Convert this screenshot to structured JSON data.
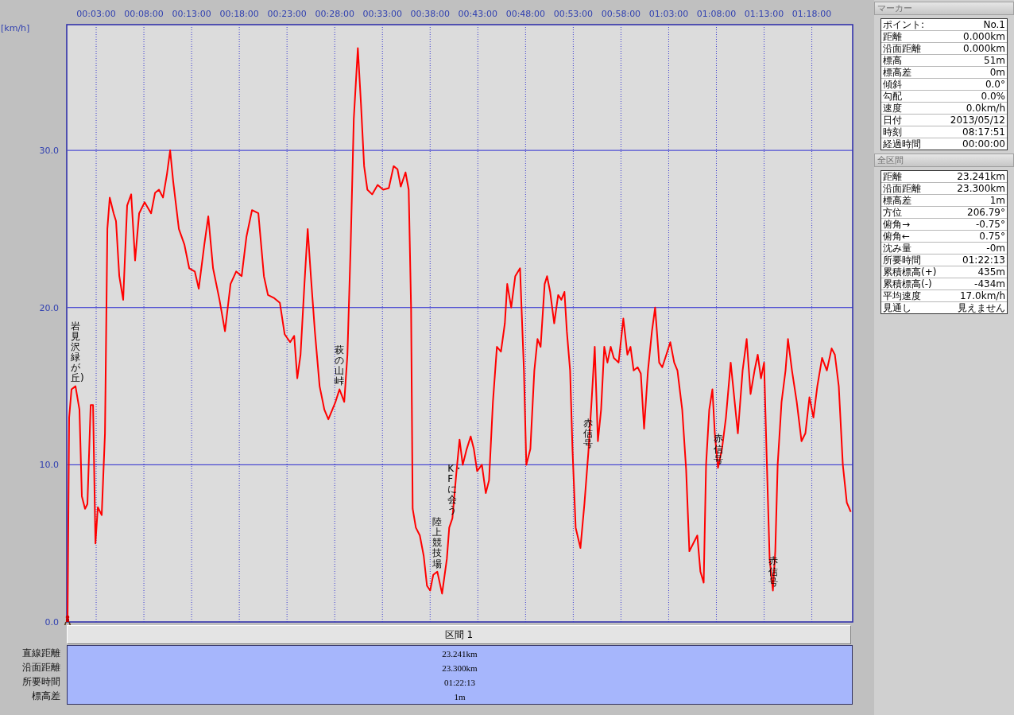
{
  "chart": {
    "chart_data": {
      "type": "line",
      "ylabel": "[km/h]",
      "x": [
        0,
        0.17,
        0.42,
        0.83,
        1.25,
        1.5,
        1.83,
        2.08,
        2.42,
        2.67,
        2.92,
        3.17,
        3.58,
        3.92,
        4.17,
        4.42,
        4.83,
        5.08,
        5.42,
        5.83,
        6.25,
        6.67,
        7.08,
        7.5,
        8.08,
        8.75,
        9.17,
        9.58,
        10,
        10.42,
        10.75,
        11.08,
        11.67,
        12.25,
        12.75,
        13.33,
        13.75,
        14.33,
        14.75,
        15.25,
        15.92,
        16.5,
        17.08,
        17.67,
        18.25,
        18.75,
        19.33,
        20,
        20.58,
        21,
        21.67,
        22.25,
        22.75,
        23.33,
        23.75,
        24.08,
        24.42,
        24.83,
        25.17,
        25.5,
        25.92,
        26.42,
        26.92,
        27.33,
        27.75,
        28.08,
        28.5,
        29,
        29.33,
        29.67,
        30,
        30.42,
        30.75,
        31.08,
        31.42,
        31.92,
        32.5,
        33.08,
        33.67,
        34.17,
        34.58,
        34.92,
        35.42,
        35.75,
        36,
        36.17,
        36.5,
        36.92,
        37.33,
        37.67,
        38,
        38.33,
        38.75,
        39.25,
        39.75,
        40,
        40.33,
        40.75,
        41.08,
        41.42,
        41.83,
        42.25,
        42.58,
        42.92,
        43.42,
        43.83,
        44.17,
        44.58,
        45,
        45.42,
        45.83,
        46.08,
        46.5,
        46.92,
        47.42,
        47.83,
        48.08,
        48.5,
        48.92,
        49.25,
        49.58,
        50,
        50.25,
        50.58,
        51,
        51.42,
        51.75,
        52.08,
        52.33,
        52.67,
        52.92,
        53.25,
        53.75,
        54.17,
        54.58,
        54.92,
        55.25,
        55.58,
        55.92,
        56.25,
        56.58,
        56.92,
        57.25,
        57.75,
        58.25,
        58.67,
        59,
        59.33,
        59.75,
        60.08,
        60.42,
        60.83,
        61.25,
        61.58,
        62,
        62.33,
        62.75,
        63.17,
        63.58,
        63.92,
        64.42,
        64.83,
        65.17,
        65.58,
        66,
        66.33,
        66.67,
        66.92,
        67.25,
        67.58,
        67.83,
        68.17,
        68.58,
        69,
        69.5,
        69.83,
        70.25,
        70.75,
        71.17,
        71.58,
        72,
        72.33,
        72.67,
        73,
        73.25,
        73.58,
        73.92,
        74.17,
        74.42,
        74.83,
        75.25,
        75.5,
        75.92,
        76.42,
        76.92,
        77.33,
        77.75,
        78.17,
        78.58,
        79.08,
        79.58,
        80.08,
        80.42,
        80.83,
        81.25,
        81.67,
        82.08
      ],
      "series": [
        {
          "color": "#ff0000",
          "values": [
            0,
            13,
            14.8,
            15,
            13.5,
            8,
            7.2,
            7.5,
            13.8,
            13.8,
            5,
            7.3,
            6.8,
            12,
            25,
            27,
            26,
            25.5,
            22,
            20.5,
            26.5,
            27.2,
            23,
            26,
            26.7,
            26,
            27.3,
            27.5,
            27,
            28.5,
            30,
            28,
            25,
            24,
            22.5,
            22.3,
            21.2,
            24,
            25.8,
            22.5,
            20.5,
            18.5,
            21.5,
            22.3,
            22,
            24.5,
            26.2,
            26,
            22,
            20.8,
            20.6,
            20.3,
            18.3,
            17.8,
            18.2,
            15.5,
            17,
            21.5,
            25,
            22,
            18.5,
            15,
            13.5,
            12.9,
            13.5,
            14,
            14.8,
            14,
            17,
            24,
            32,
            36.5,
            33,
            29,
            27.5,
            27.2,
            27.8,
            27.5,
            27.6,
            29,
            28.8,
            27.7,
            28.6,
            27.5,
            20,
            7.2,
            6,
            5.5,
            4.2,
            2.3,
            2,
            3,
            3.2,
            1.8,
            4,
            6,
            6.6,
            9.5,
            11.6,
            10,
            11,
            11.8,
            11,
            9.6,
            10,
            8.2,
            9,
            14,
            17.5,
            17.2,
            19,
            21.5,
            20,
            22,
            22.5,
            16,
            10,
            11,
            16,
            18,
            17.5,
            21.5,
            22,
            21,
            19,
            20.8,
            20.5,
            21,
            18.5,
            16,
            11,
            6,
            4.7,
            7.5,
            10.8,
            14,
            17.5,
            11.5,
            13.5,
            17.5,
            16.5,
            17.5,
            16.8,
            16.5,
            19.3,
            17,
            17.5,
            16,
            16.2,
            15.8,
            12.3,
            16,
            18.5,
            20,
            16.5,
            16.2,
            17,
            17.8,
            16.5,
            16,
            13.5,
            9.7,
            4.5,
            5,
            5.5,
            3.2,
            2.5,
            10,
            13.5,
            14.8,
            12,
            9.8,
            11,
            13,
            16.5,
            14.5,
            12,
            16,
            18,
            14.5,
            16,
            17,
            15.5,
            16.5,
            11,
            4,
            2,
            4.5,
            10,
            14,
            16,
            18,
            16,
            14,
            11.5,
            12,
            14.3,
            13,
            15,
            16.8,
            16,
            17.4,
            17,
            15,
            10,
            7.6,
            7
          ]
        }
      ],
      "xlim": [
        0,
        82.2
      ],
      "ylim": [
        0,
        38
      ],
      "grid": true,
      "xticks": [
        {
          "value": 3,
          "label": "00:03:00"
        },
        {
          "value": 8,
          "label": "00:08:00"
        },
        {
          "value": 13,
          "label": "00:13:00"
        },
        {
          "value": 18,
          "label": "00:18:00"
        },
        {
          "value": 23,
          "label": "00:23:00"
        },
        {
          "value": 28,
          "label": "00:28:00"
        },
        {
          "value": 33,
          "label": "00:33:00"
        },
        {
          "value": 38,
          "label": "00:38:00"
        },
        {
          "value": 43,
          "label": "00:43:00"
        },
        {
          "value": 48,
          "label": "00:48:00"
        },
        {
          "value": 53,
          "label": "00:53:00"
        },
        {
          "value": 58,
          "label": "00:58:00"
        },
        {
          "value": 63,
          "label": "01:03:00"
        },
        {
          "value": 68,
          "label": "01:08:00"
        },
        {
          "value": 73,
          "label": "01:13:00"
        },
        {
          "value": 78,
          "label": "01:18:00"
        }
      ],
      "yticks": [
        {
          "value": 0,
          "label": "0.0"
        },
        {
          "value": 10,
          "label": "10.0"
        },
        {
          "value": 20,
          "label": "20.0"
        },
        {
          "value": 30,
          "label": "30.0"
        }
      ],
      "annotations": [
        {
          "x": 0.83,
          "y": 15,
          "text": "岩見沢緑が丘)"
        },
        {
          "x": 28.5,
          "y": 14.8,
          "text": "萩の山峠"
        },
        {
          "x": 40.33,
          "y": 6.6,
          "text": "K・Fに会う"
        },
        {
          "x": 38.75,
          "y": 3.2,
          "text": "陸上競技場"
        },
        {
          "x": 54.58,
          "y": 10.8,
          "text": "赤信号"
        },
        {
          "x": 68.17,
          "y": 9.8,
          "text": "赤信号"
        },
        {
          "x": 73.92,
          "y": 2,
          "text": "赤信号"
        }
      ]
    }
  },
  "section_table": {
    "header": "区間 1",
    "rows": [
      {
        "label": "直線距離",
        "value": "23.241km"
      },
      {
        "label": "沿面距離",
        "value": "23.300km"
      },
      {
        "label": "所要時間",
        "value": "01:22:13"
      },
      {
        "label": "標高差",
        "value": "1m"
      }
    ]
  },
  "side_panels": [
    {
      "title": "マーカー",
      "rows": [
        {
          "label": "ポイント:",
          "value": "No.1"
        },
        {
          "label": "距離",
          "value": "0.000km"
        },
        {
          "label": "沿面距離",
          "value": "0.000km"
        },
        {
          "label": "標高",
          "value": "51m"
        },
        {
          "label": "標高差",
          "value": "0m"
        },
        {
          "label": "傾斜",
          "value": "0.0°"
        },
        {
          "label": "勾配",
          "value": "0.0%"
        },
        {
          "label": "速度",
          "value": "0.0km/h"
        },
        {
          "label": "日付",
          "value": "2013/05/12"
        },
        {
          "label": "時刻",
          "value": "08:17:51"
        },
        {
          "label": "経過時間",
          "value": "00:00:00"
        }
      ]
    },
    {
      "title": "全区間",
      "rows": [
        {
          "label": "距離",
          "value": "23.241km"
        },
        {
          "label": "沿面距離",
          "value": "23.300km"
        },
        {
          "label": "標高差",
          "value": "1m"
        },
        {
          "label": "方位",
          "value": "206.79°"
        },
        {
          "label": "俯角→",
          "value": "-0.75°"
        },
        {
          "label": "俯角←",
          "value": "0.75°"
        },
        {
          "label": "沈み量",
          "value": "-0m"
        },
        {
          "label": "所要時間",
          "value": "01:22:13"
        },
        {
          "label": "累積標高(+)",
          "value": "435m"
        },
        {
          "label": "累積標高(-)",
          "value": "-434m"
        },
        {
          "label": "平均速度",
          "value": "17.0km/h"
        },
        {
          "label": "見通し",
          "value": "見えません"
        }
      ]
    }
  ]
}
